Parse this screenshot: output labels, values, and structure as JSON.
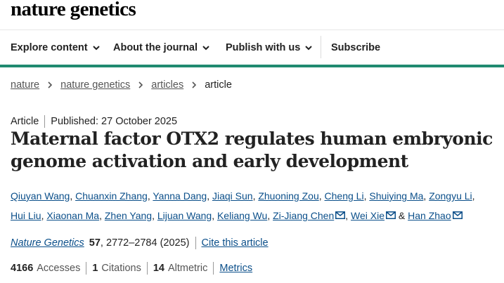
{
  "brand": {
    "logo_text": "nature genetics"
  },
  "nav": {
    "items": [
      {
        "label": "Explore content"
      },
      {
        "label": "About the journal"
      },
      {
        "label": "Publish with us"
      }
    ],
    "subscribe": "Subscribe"
  },
  "breadcrumb": [
    "nature",
    "nature genetics",
    "articles",
    "article"
  ],
  "article": {
    "type": "Article",
    "published": "Published: 27 October 2025",
    "title_line1": "Maternal factor OTX2 regulates human embryonic",
    "title_line2": "genome activation and early development",
    "authors": [
      "Qiuyan Wang",
      "Chuanxin Zhang",
      "Yanna Dang",
      "Jiaqi Sun",
      "Zhuoning Zou",
      "Cheng Li",
      "Shuiying Ma",
      "Zongyu Li",
      "Hui Liu",
      "Xiaonan Ma",
      "Zhen Yang",
      "Lijuan Wang",
      "Keliang Wu",
      "Zi-Jiang Chen",
      "Wei Xie",
      "Han Zhao"
    ],
    "author_sep": ",",
    "amp": "&",
    "journal": "Nature Genetics",
    "volume": "57",
    "pages_year": ", 2772–2784 (2025)",
    "cite_link": "Cite this article"
  },
  "metrics": {
    "accesses_count": "4166",
    "accesses_label": "Accesses",
    "citations_count": "1",
    "citations_label": "Citations",
    "altmetric_count": "14",
    "altmetric_label": "Altmetric",
    "metrics_link": "Metrics"
  },
  "colors": {
    "accent_rule": "#1f8a70",
    "link": "#0b4f8a"
  },
  "icons": {
    "chevron": "chevron-down-icon",
    "crumb": "chevron-right-icon",
    "mail": "mail-icon"
  }
}
